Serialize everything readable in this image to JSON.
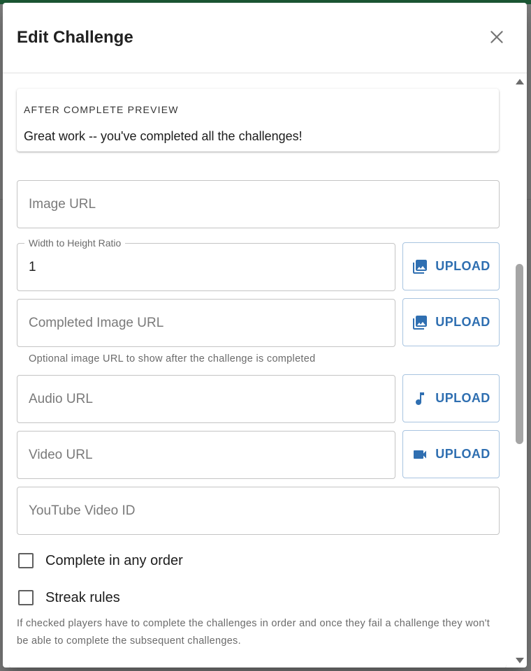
{
  "dialog": {
    "title": "Edit Challenge"
  },
  "preview": {
    "label": "AFTER COMPLETE PREVIEW",
    "text": "Great work -- you've completed all the challenges!"
  },
  "fields": {
    "image_url": {
      "placeholder": "Image URL",
      "value": ""
    },
    "ratio": {
      "label": "Width to Height Ratio",
      "value": "1"
    },
    "completed_image_url": {
      "placeholder": "Completed Image URL",
      "value": "",
      "helper": "Optional image URL to show after the challenge is completed"
    },
    "audio_url": {
      "placeholder": "Audio URL",
      "value": ""
    },
    "video_url": {
      "placeholder": "Video URL",
      "value": ""
    },
    "youtube_id": {
      "placeholder": "YouTube Video ID",
      "value": ""
    }
  },
  "buttons": {
    "upload_label": "UPLOAD"
  },
  "checkboxes": {
    "any_order": {
      "label": "Complete in any order",
      "checked": false
    },
    "streak": {
      "label": "Streak rules",
      "checked": false
    }
  },
  "help_text": "If checked players have to complete the challenges in order and once they fail a challenge they won't be able to complete the subsequent challenges.",
  "icons": {
    "close": "close-icon",
    "image": "image-icon",
    "music": "music-note-icon",
    "video": "videocam-icon"
  },
  "colors": {
    "accent": "#2f6fb1",
    "topbar": "#1d5a36"
  }
}
